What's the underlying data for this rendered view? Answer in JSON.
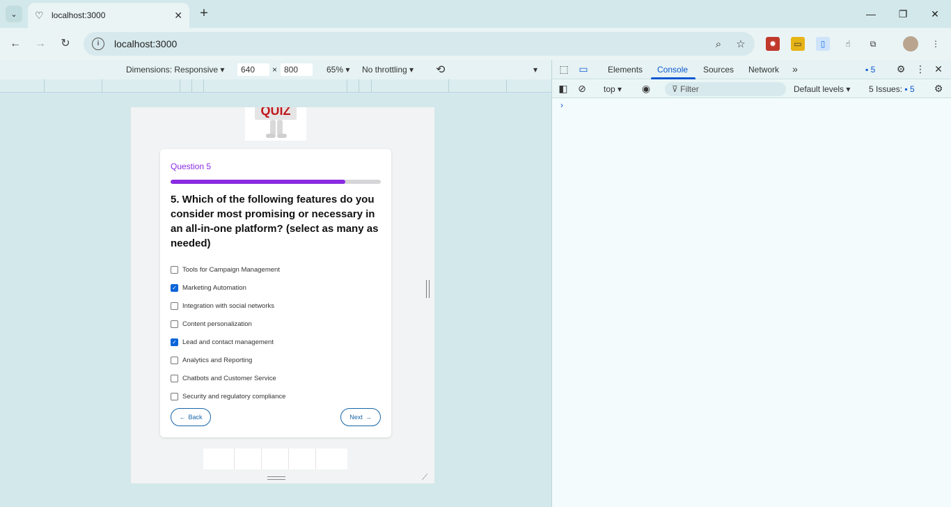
{
  "browser": {
    "tab_title": "localhost:3000",
    "new_tab": "+",
    "url": "localhost:3000",
    "window_controls": [
      "—",
      "❐",
      "✕"
    ]
  },
  "device_toolbar": {
    "dimensions_label": "Dimensions: Responsive",
    "width": "640",
    "times": "×",
    "height": "800",
    "zoom": "65%",
    "throttling": "No throttling"
  },
  "devtools": {
    "tabs": [
      "Elements",
      "Console",
      "Sources",
      "Network"
    ],
    "active_tab": "Console",
    "messages_count": "5",
    "context": "top",
    "filter_placeholder": "Filter",
    "levels": "Default levels",
    "issues_label": "5 Issues:",
    "issues_count": "5",
    "prompt": "›"
  },
  "quiz": {
    "logo_text": "QUIZ",
    "question_number": "Question 5",
    "progress": 0.83,
    "question_text": "5. Which of the following features do you consider most promising or necessary in an all-in-one platform? (select as many as needed)",
    "options": [
      {
        "label": "Tools for Campaign Management",
        "checked": false
      },
      {
        "label": "Marketing Automation",
        "checked": true
      },
      {
        "label": "Integration with social networks",
        "checked": false
      },
      {
        "label": "Content personalization",
        "checked": false
      },
      {
        "label": "Lead and contact management",
        "checked": true
      },
      {
        "label": "Analytics and Reporting",
        "checked": false
      },
      {
        "label": "Chatbots and Customer Service",
        "checked": false
      },
      {
        "label": "Security and regulatory compliance",
        "checked": false
      }
    ],
    "back_label": "Back",
    "next_label": "Next"
  },
  "colors": {
    "accent": "#8a2be2",
    "button_border": "#1565a8",
    "checkbox": "#0a64d8"
  }
}
